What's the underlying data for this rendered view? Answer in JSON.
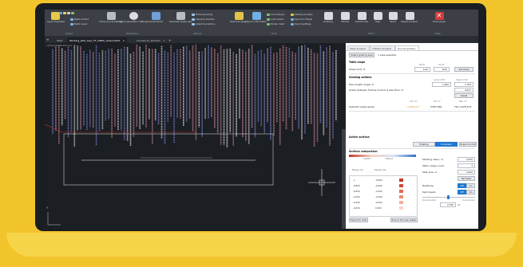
{
  "ribbon": {
    "groups": [
      {
        "label": "Layers",
        "buttons": [
          {
            "label": "Layer Properties"
          }
        ],
        "small": [
          "Make Current",
          "Match Layer"
        ]
      },
      {
        "label": "Workspace",
        "buttons": [
          {
            "label": "Frame & pole settings"
          },
          {
            "label": "Layout generation settings"
          },
          {
            "label": "Import terrain"
          }
        ]
      },
      {
        "label": "Actions",
        "buttons": [
          {
            "label": "Generate single area"
          }
        ],
        "small": [
          "Frame grouping",
          "Capacity iteration",
          "Adapt to positions"
        ]
      },
      {
        "label": "Tools",
        "buttons": [
          {
            "label": "Electrical design"
          },
          {
            "label": "Layout information"
          }
        ],
        "small": [
          "Civil analysis",
          "Cost creator",
          "Terrain mesh",
          "Shading analysis",
          "Export to PVsyst",
          "Import settings"
        ]
      },
      {
        "label": "Other",
        "buttons": [
          {
            "label": "Academy"
          },
          {
            "label": "Tutorial"
          },
          {
            "label": "Submit idea"
          },
          {
            "label": "Help"
          },
          {
            "label": "About"
          },
          {
            "label": "Report problem"
          }
        ]
      },
      {
        "label": "Close",
        "buttons": [
          {
            "label": "Close plugin"
          }
        ]
      }
    ]
  },
  "tabs": [
    {
      "label": "Start"
    },
    {
      "label": "Working_with_topo_FT_C6MA_version2021"
    },
    {
      "label": "Convert_to_PVcase*"
    }
  ],
  "viewport_label": "[-][Top][2D Wireframe]",
  "axis_label": "Y",
  "panel": {
    "tabs": [
      "Slope analysis",
      "Collision analysis",
      "Ground grading"
    ],
    "select_button": "Select grading area",
    "selected_text": "1 area selected",
    "table_slope": {
      "heading": "Table slope",
      "col_north": "North",
      "col_south": "South",
      "row_label": "Slope limit, %",
      "north_value": "5.00",
      "south_value": "8.00",
      "set_button": "Set slope"
    },
    "grading": {
      "heading": "Grading actions",
      "col_lower": "Lower limit",
      "col_upper": "Upper limit",
      "pole_label": "Pole length range, m",
      "pole_lower": "1,000",
      "pole_upper": "1,700",
      "grade_label": "Grade between frames if pitch is less than, m",
      "grade_value": "4,677",
      "grade_button": "Grade",
      "col_cut": "Cut, m³",
      "col_fill": "Fill, m³",
      "col_net": "Net, m³",
      "selected_label": "Selected areas grade",
      "cut_value": "-3,456,017",
      "fill_value": "5387,460",
      "net_value": "FILL 1978,474"
    },
    "surface": {
      "heading": "Active surface",
      "existing": "Existing",
      "proposed": "Proposed",
      "export_csv": "Export to CSV"
    },
    "comparison": {
      "heading": "Surface comparison",
      "legend_left": "Cut/Fill",
      "legend_right": "Fill/Cut",
      "col_from": "Range min",
      "col_to": "Range max",
      "rows": [
        {
          "from": "-∞",
          "to": "-0,850",
          "color": "#c0392b"
        },
        {
          "from": "-0,850",
          "to": "-0,650",
          "color": "#d04a3a"
        },
        {
          "from": "-0,650",
          "to": "-0,450",
          "color": "#de6a55"
        },
        {
          "from": "-0,450",
          "to": "-0,250",
          "color": "#e88b75"
        },
        {
          "from": "-0,250",
          "to": "-0,050",
          "color": "#f0b09d"
        },
        {
          "from": "-0,050",
          "to": "0,050",
          "color": "#f5d3c6"
        }
      ],
      "export_cad": "Export to CAD",
      "export_view": "Export 3D view (beta)",
      "start_label": "Starting value, m",
      "start_value": "0,050",
      "range_label": "Table range count",
      "range_value": "3",
      "step_label": "Step size, m",
      "step_value": "0,200",
      "set_table": "Set table",
      "heatmap_label": "Heatmap",
      "spot_label": "Spot levels",
      "off": "Off",
      "on": "On",
      "slider_left": "Decremental",
      "slider_right": "Incremental",
      "slider_value": "2,750",
      "slider_unit": "m"
    }
  },
  "colors": {
    "accent": "#1f78d1",
    "rows_blue": "#7b86d6",
    "rows_pink": "#d28aa0",
    "rows_white": "#e8e8f0",
    "section_red": "#c0392b"
  }
}
